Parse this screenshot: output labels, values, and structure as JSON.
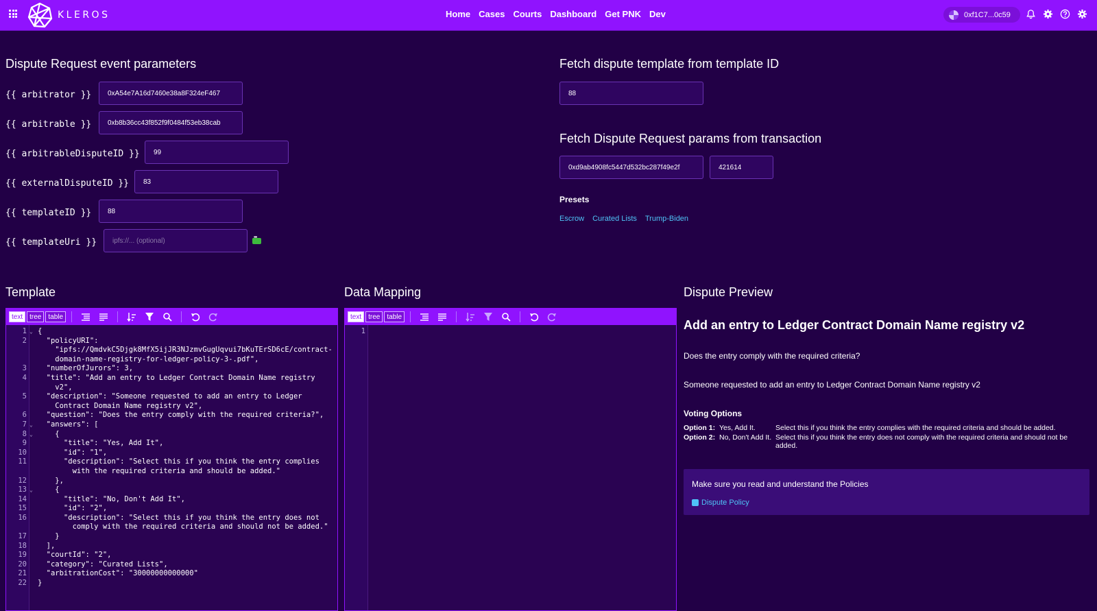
{
  "brand": "KLEROS",
  "nav": [
    "Home",
    "Cases",
    "Courts",
    "Dashboard",
    "Get PNK",
    "Dev"
  ],
  "wallet": "0xf1C7...0c59",
  "params": {
    "title": "Dispute Request event parameters",
    "fields": [
      {
        "label": "{{ arbitrator }}",
        "value": "0xA54e7A16d7460e38a8F324eF467"
      },
      {
        "label": "{{ arbitrable }}",
        "value": "0xb8b36cc43f852f9f0484f53eb38cab"
      },
      {
        "label": "{{ arbitrableDisputeID }}",
        "value": "99"
      },
      {
        "label": "{{ externalDisputeID }}",
        "value": "83"
      },
      {
        "label": "{{ templateID }}",
        "value": "88"
      },
      {
        "label": "{{ templateUri }}",
        "placeholder": "ipfs://... (optional)"
      }
    ]
  },
  "fetch_template": {
    "title": "Fetch dispute template from template ID",
    "value": "88"
  },
  "fetch_tx": {
    "title": "Fetch Dispute Request params from transaction",
    "tx_value": "0xd9ab4908fc5447d532bc287f49e2f",
    "chain_value": "421614"
  },
  "presets": {
    "label": "Presets",
    "items": [
      "Escrow",
      "Curated Lists",
      "Trump-Biden"
    ]
  },
  "template": {
    "title": "Template"
  },
  "mapping": {
    "title": "Data Mapping"
  },
  "editor_modes": [
    "text",
    "tree",
    "table"
  ],
  "preview": {
    "title": "Dispute Preview",
    "heading": "Add an entry to Ledger Contract Domain Name registry v2",
    "question": "Does the entry comply with the required criteria?",
    "description": "Someone requested to add an entry to Ledger Contract Domain Name registry v2",
    "voting_label": "Voting Options",
    "options": [
      {
        "key": "Option 1:",
        "title": "Yes, Add It.",
        "desc": "Select this if you think the entry complies with the required criteria and should be added."
      },
      {
        "key": "Option 2:",
        "title": "No, Don't Add It.",
        "desc": "Select this if you think the entry does not comply with the required criteria and should not be added."
      }
    ],
    "policy_text": "Make sure you read and understand the Policies",
    "policy_link": "Dispute Policy"
  },
  "template_code": [
    {
      "n": "1",
      "f": "⌄",
      "t": "{"
    },
    {
      "n": "2",
      "f": "",
      "t": "  \"policyURI\":"
    },
    {
      "n": "",
      "f": "",
      "t": "    \"ipfs://QmdvkC5Djgk8MfX5ijJR3NJzmvGugUqvui7bKuTErSD6cE/contract-"
    },
    {
      "n": "",
      "f": "",
      "t": "    domain-name-registry-for-ledger-policy-3-.pdf\","
    },
    {
      "n": "3",
      "f": "",
      "t": "  \"numberOfJurors\": 3,"
    },
    {
      "n": "4",
      "f": "",
      "t": "  \"title\": \"Add an entry to Ledger Contract Domain Name registry"
    },
    {
      "n": "",
      "f": "",
      "t": "    v2\","
    },
    {
      "n": "5",
      "f": "",
      "t": "  \"description\": \"Someone requested to add an entry to Ledger"
    },
    {
      "n": "",
      "f": "",
      "t": "    Contract Domain Name registry v2\","
    },
    {
      "n": "6",
      "f": "",
      "t": "  \"question\": \"Does the entry comply with the required criteria?\","
    },
    {
      "n": "7",
      "f": "⌄",
      "t": "  \"answers\": ["
    },
    {
      "n": "8",
      "f": "⌄",
      "t": "    {"
    },
    {
      "n": "9",
      "f": "",
      "t": "      \"title\": \"Yes, Add It\","
    },
    {
      "n": "10",
      "f": "",
      "t": "      \"id\": \"1\","
    },
    {
      "n": "11",
      "f": "",
      "t": "      \"description\": \"Select this if you think the entry complies"
    },
    {
      "n": "",
      "f": "",
      "t": "        with the required criteria and should be added.\""
    },
    {
      "n": "12",
      "f": "",
      "t": "    },"
    },
    {
      "n": "13",
      "f": "⌄",
      "t": "    {"
    },
    {
      "n": "14",
      "f": "",
      "t": "      \"title\": \"No, Don't Add It\","
    },
    {
      "n": "15",
      "f": "",
      "t": "      \"id\": \"2\","
    },
    {
      "n": "16",
      "f": "",
      "t": "      \"description\": \"Select this if you think the entry does not"
    },
    {
      "n": "",
      "f": "",
      "t": "        comply with the required criteria and should not be added.\""
    },
    {
      "n": "17",
      "f": "",
      "t": "    }"
    },
    {
      "n": "18",
      "f": "",
      "t": "  ],"
    },
    {
      "n": "19",
      "f": "",
      "t": "  \"courtId\": \"2\","
    },
    {
      "n": "20",
      "f": "",
      "t": "  \"category\": \"Curated Lists\","
    },
    {
      "n": "21",
      "f": "",
      "t": "  \"arbitrationCost\": \"30000000000000\""
    },
    {
      "n": "22",
      "f": "",
      "t": "}"
    }
  ],
  "mapping_code": [
    {
      "n": "1",
      "f": "",
      "t": ""
    }
  ]
}
